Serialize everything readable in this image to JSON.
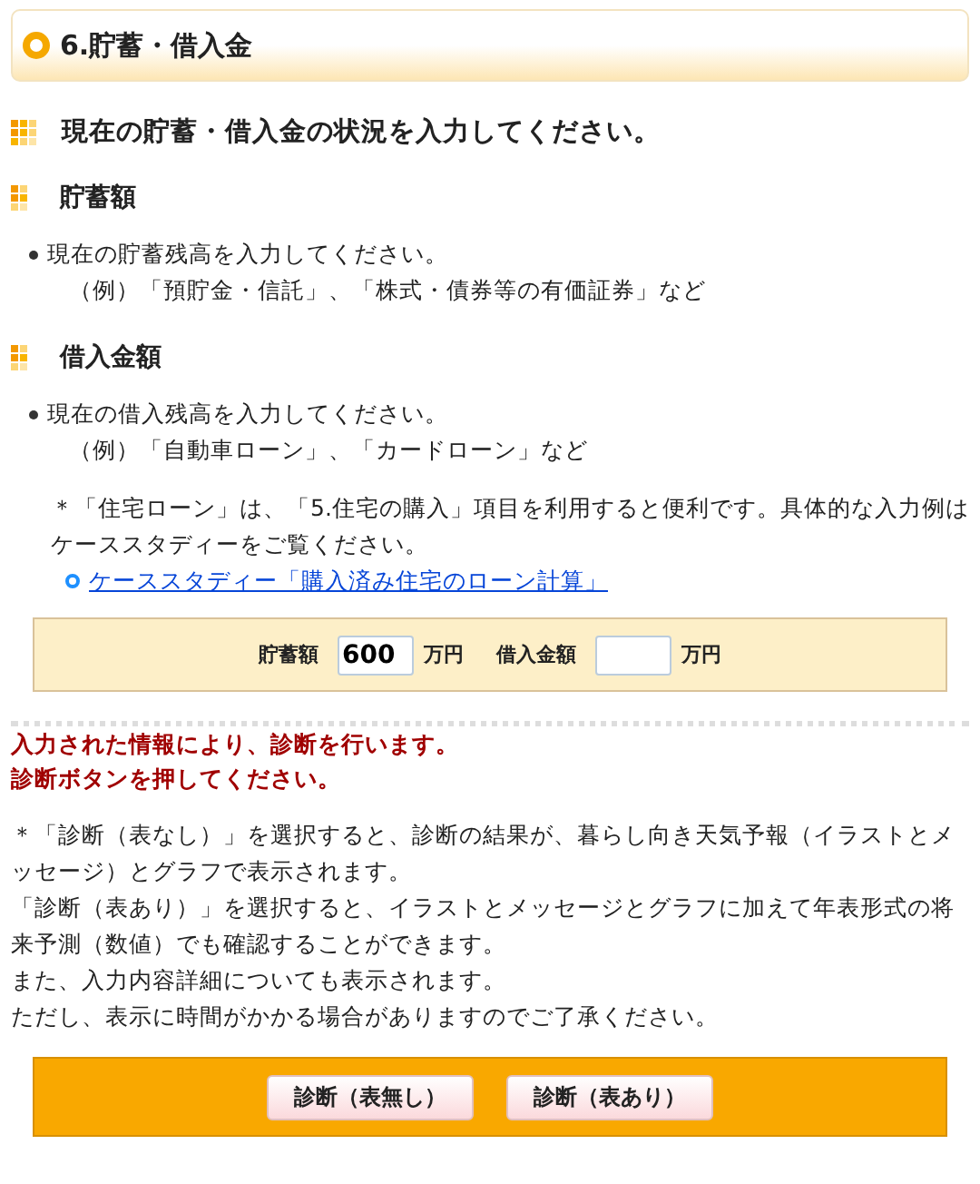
{
  "section_title": "6.貯蓄・借入金",
  "heading": "現在の貯蓄・借入金の状況を入力してください。",
  "groups": [
    {
      "title": "貯蓄額",
      "bullet": "現在の貯蓄残高を入力してください。",
      "example": "（例）「預貯金・信託」、「株式・債券等の有価証券」など"
    },
    {
      "title": "借入金額",
      "bullet": "現在の借入残高を入力してください。",
      "example": "（例）「自動車ローン」、「カードローン」など"
    }
  ],
  "note": "＊「住宅ローン」は、「5.住宅の購入」項目を利用すると便利です。具体的な入力例はケーススタディーをご覧ください。",
  "link": "ケーススタディー「購入済み住宅のローン計算」",
  "inputs": [
    {
      "label": "貯蓄額",
      "value": "600",
      "unit": "万円"
    },
    {
      "label": "借入金額",
      "unit": "万円"
    }
  ],
  "notice": [
    "入力された情報により、診断を行います。",
    "診断ボタンを押してください。"
  ],
  "explanation": [
    "＊「診断（表なし）」を選択すると、診断の結果が、暮らし向き天気予報（イラストとメッセージ）とグラフで表示されます。",
    "「診断（表あり）」を選択すると、イラストとメッセージとグラフに加えて年表形式の将来予測（数値）でも確認することができます。",
    "また、入力内容詳細についても表示されます。",
    "ただし、表示に時間がかかる場合がありますのでご了承ください。"
  ],
  "buttons": [
    "診断（表無し）",
    "診断（表あり）"
  ]
}
